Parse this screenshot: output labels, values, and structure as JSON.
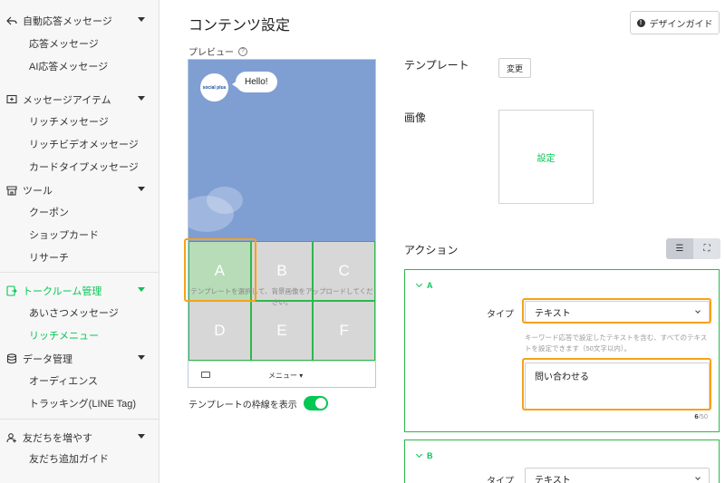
{
  "sidebar": {
    "sections": [
      {
        "label": "自動応答メッセージ",
        "icon": "reply-icon",
        "items": [
          "応答メッセージ",
          "AI応答メッセージ"
        ]
      },
      {
        "label": "メッセージアイテム",
        "icon": "message-plus-icon",
        "items": [
          "リッチメッセージ",
          "リッチビデオメッセージ",
          "カードタイプメッセージ"
        ]
      },
      {
        "label": "ツール",
        "icon": "store-icon",
        "items": [
          "クーポン",
          "ショップカード",
          "リサーチ"
        ]
      },
      {
        "label": "トークルーム管理",
        "icon": "chatroom-icon",
        "items": [
          "あいさつメッセージ",
          "リッチメニュー"
        ]
      },
      {
        "label": "データ管理",
        "icon": "database-icon",
        "items": [
          "オーディエンス",
          "トラッキング(LINE Tag)"
        ]
      },
      {
        "label": "友だちを増やす",
        "icon": "add-friend-icon",
        "items": [
          "友だち追加ガイド"
        ]
      }
    ],
    "active_section": "トークルーム管理",
    "active_item": "リッチメニュー"
  },
  "header": {
    "title": "コンテンツ設定",
    "guide_button": "デザインガイド"
  },
  "preview": {
    "label": "プレビュー",
    "avatar_text": "social plus",
    "bubble_text": "Hello!",
    "cells": [
      "A",
      "B",
      "C",
      "D",
      "E",
      "F"
    ],
    "selected_cell": "A",
    "overlay_text": "テンプレートを選択して、背景画像をアップロードしてください。",
    "menu_label": "メニュー ▾",
    "frame_toggle_label": "テンプレートの枠線を表示",
    "frame_toggle_on": true
  },
  "settings": {
    "template_label": "テンプレート",
    "change_button": "変更",
    "image_label": "画像",
    "image_set_button": "設定",
    "action_label": "アクション"
  },
  "actions": [
    {
      "name": "A",
      "type_label": "タイプ",
      "type_value": "テキスト",
      "help": "キーワード応答で設定したテキストを含む、すべてのテキストを設定できます（50文字以内）。",
      "text": "問い合わせる",
      "count": "6",
      "max": "/50"
    },
    {
      "name": "B",
      "type_label": "タイプ",
      "type_value": "テキスト"
    }
  ],
  "colors": {
    "accent": "#06c755",
    "highlight": "#f5a21b",
    "preview_bg": "#7f9fd3"
  }
}
